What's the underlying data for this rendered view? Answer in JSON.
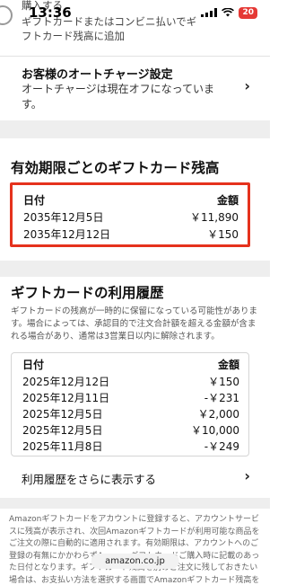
{
  "status_bar": {
    "time": "13:36",
    "battery": "20",
    "battery_color": "#e53935"
  },
  "top_option": {
    "line0": "購入する",
    "line1": "ギフトカードまたはコンビニ払いでギ",
    "line2": "フトカード残高に追加"
  },
  "auto_charge": {
    "title": "お客様のオートチャージ設定",
    "line1": "オートチャージは現在オフになっていま",
    "line2": "す。"
  },
  "balance_by_expiry": {
    "title": "有効期限ごとのギフトカード残高",
    "header": {
      "date": "日付",
      "amount": "金額"
    },
    "rows": [
      {
        "date": "2035年12月5日",
        "amount": "￥11,890"
      },
      {
        "date": "2035年12月12日",
        "amount": "￥150"
      }
    ],
    "highlight_color": "#e5321d"
  },
  "history": {
    "title": "ギフトカードの利用履歴",
    "note": "ギフトカードの残高が一時的に保留になっている可能性があります。場合によっては、承認目的で注文合計額を超える金額が含まれる場合があり、通常は3営業日以内に解除されます。",
    "header": {
      "date": "日付",
      "amount": "金額"
    },
    "rows": [
      {
        "date": "2025年12月12日",
        "amount": "￥150"
      },
      {
        "date": "2025年12月11日",
        "amount": "-￥231"
      },
      {
        "date": "2025年12月5日",
        "amount": "￥2,000"
      },
      {
        "date": "2025年12月5日",
        "amount": "￥10,000"
      },
      {
        "date": "2025年11月8日",
        "amount": "-￥249"
      }
    ],
    "more_label": "利用履歴をさらに表示する"
  },
  "footer": {
    "text": "Amazonギフトカードをアカウントに登録すると、アカウントサービスに残高が表示され、次回Amazonギフトカードが利用可能な商品をご注文の際に自動的に適用されます。有効期限は、アカウントへのご登録の有無にかかわらずAmazonギフトカードご購入時に記載のあった日付となります。ギフトカード残高を別のご注文に残しておきたい場合は、お支払い方法を選択する画面でAmazonギフトカード残高を使用しないで注文を確定します。"
  },
  "browser": {
    "url": "amazon.co.jp"
  }
}
